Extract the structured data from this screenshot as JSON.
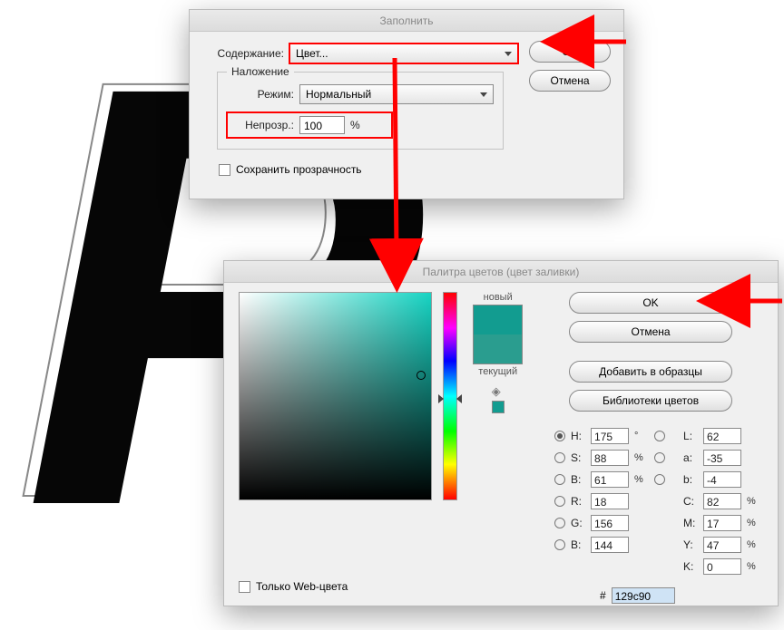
{
  "fill_dialog": {
    "title": "Заполнить",
    "contents_label": "Содержание:",
    "contents_value": "Цвет...",
    "blending_group": "Наложение",
    "mode_label": "Режим:",
    "mode_value": "Нормальный",
    "opacity_label": "Непрозр.:",
    "opacity_value": "100",
    "opacity_unit": "%",
    "preserve_label": "Сохранить прозрачность",
    "ok": "OK",
    "cancel": "Отмена"
  },
  "color_picker": {
    "title": "Палитра цветов (цвет заливки)",
    "new_label": "новый",
    "current_label": "текущий",
    "ok": "OK",
    "cancel": "Отмена",
    "add_swatches": "Добавить в образцы",
    "color_libraries": "Библиотеки цветов",
    "only_web": "Только Web-цвета",
    "H": {
      "label": "H:",
      "value": "175",
      "unit": "°"
    },
    "S": {
      "label": "S:",
      "value": "88",
      "unit": "%"
    },
    "Bv": {
      "label": "B:",
      "value": "61",
      "unit": "%"
    },
    "R": {
      "label": "R:",
      "value": "18"
    },
    "G": {
      "label": "G:",
      "value": "156"
    },
    "Bc": {
      "label": "B:",
      "value": "144"
    },
    "L": {
      "label": "L:",
      "value": "62"
    },
    "a": {
      "label": "a:",
      "value": "-35"
    },
    "b": {
      "label": "b:",
      "value": "-4"
    },
    "C": {
      "label": "C:",
      "value": "82",
      "unit": "%"
    },
    "M": {
      "label": "M:",
      "value": "17",
      "unit": "%"
    },
    "Y": {
      "label": "Y:",
      "value": "47",
      "unit": "%"
    },
    "K": {
      "label": "K:",
      "value": "0",
      "unit": "%"
    },
    "hex_prefix": "#",
    "hex": "129c90",
    "new_color": "#129c90",
    "current_color": "#2a9d8f"
  },
  "bg_letter": "P"
}
